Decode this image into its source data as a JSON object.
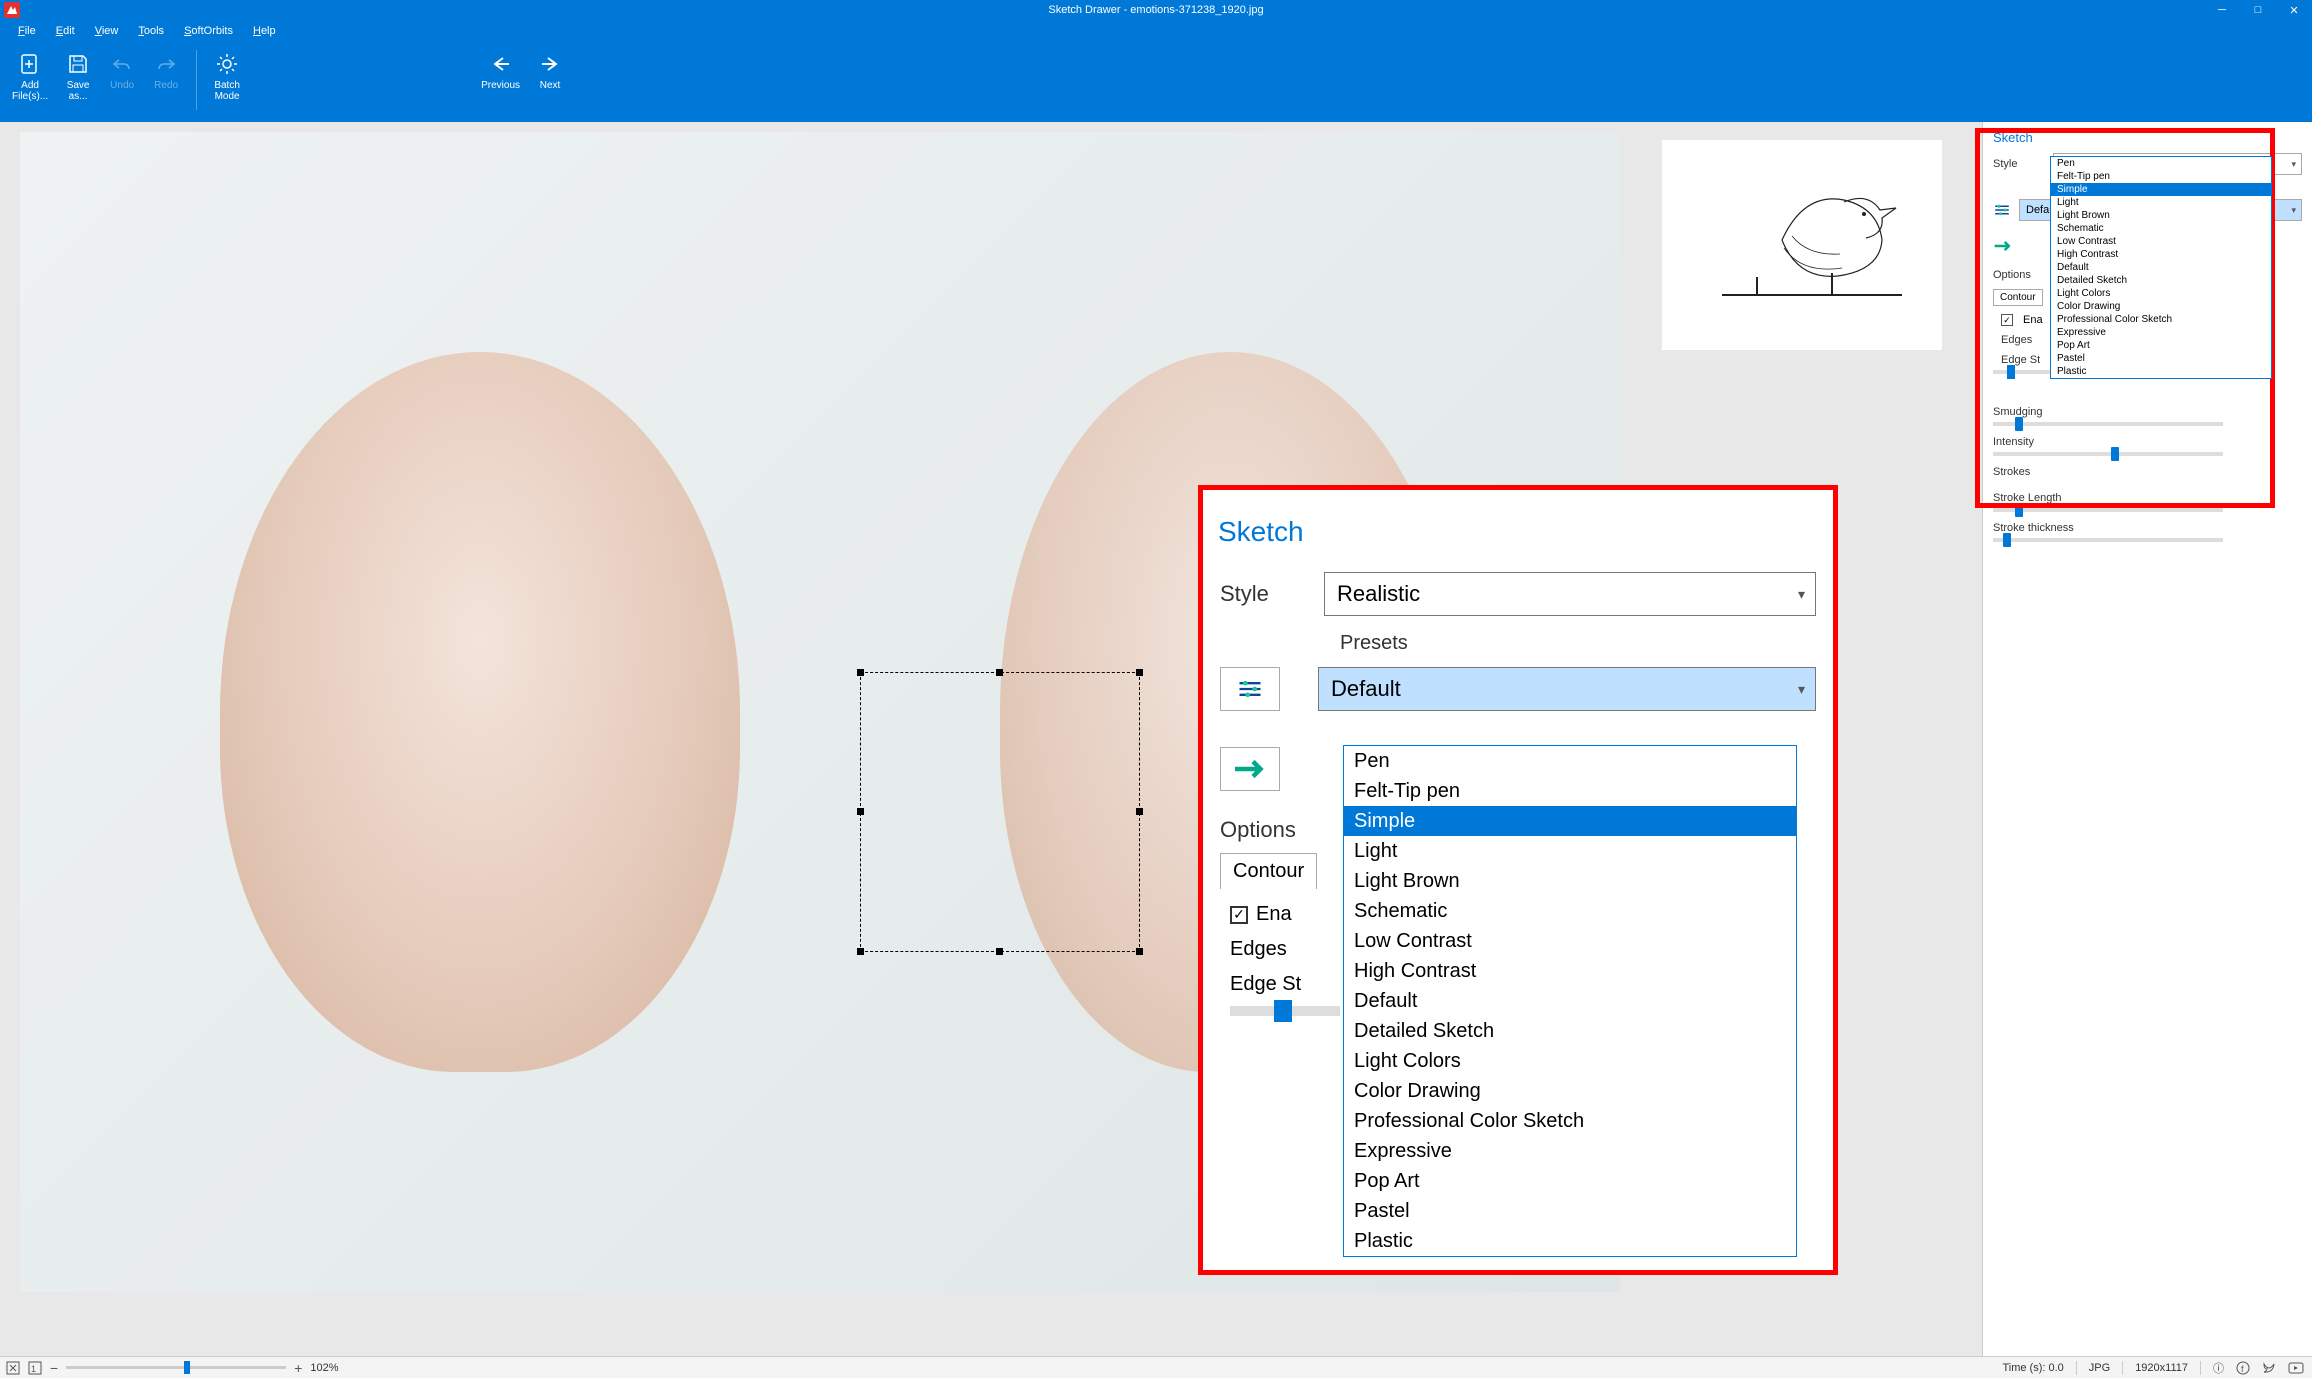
{
  "app": {
    "title": "Sketch Drawer - emotions-371238_1920.jpg"
  },
  "window": {
    "min": "─",
    "max": "□",
    "close": "✕"
  },
  "menu": {
    "file": "File",
    "edit": "Edit",
    "view": "View",
    "tools": "Tools",
    "softorbits": "SoftOrbits",
    "help": "Help"
  },
  "tools": {
    "addfiles": "Add\nFile(s)...",
    "saveas": "Save\nas...",
    "undo": "Undo",
    "redo": "Redo",
    "batch": "Batch\nMode",
    "previous": "Previous",
    "next": "Next"
  },
  "sidebar": {
    "title": "Sketch",
    "style_label": "Style",
    "style_value": "Realistic",
    "presets_label": "Presets",
    "presets_value": "Default",
    "options_label": "Options",
    "contour_tab": "Contour",
    "enable_cb": "Ena",
    "edges_label": "Edges",
    "edge_strength_label": "Edge St",
    "smudging_label": "Smudging",
    "intensity_label": "Intensity",
    "strokes_label": "Strokes",
    "stroke_length_label": "Stroke Length",
    "stroke_thickness_label": "Stroke thickness"
  },
  "presets": [
    "Pen",
    "Felt-Tip pen",
    "Simple",
    "Light",
    "Light Brown",
    "Schematic",
    "Low Contrast",
    "High Contrast",
    "Default",
    "Detailed Sketch",
    "Light Colors",
    "Color Drawing",
    "Professional Color Sketch",
    "Expressive",
    "Pop Art",
    "Pastel",
    "Plastic"
  ],
  "preset_hover": "Simple",
  "status": {
    "zoom_pct": "102%",
    "time": "Time (s): 0.0",
    "fmt": "JPG",
    "dim": "1920x1117"
  }
}
